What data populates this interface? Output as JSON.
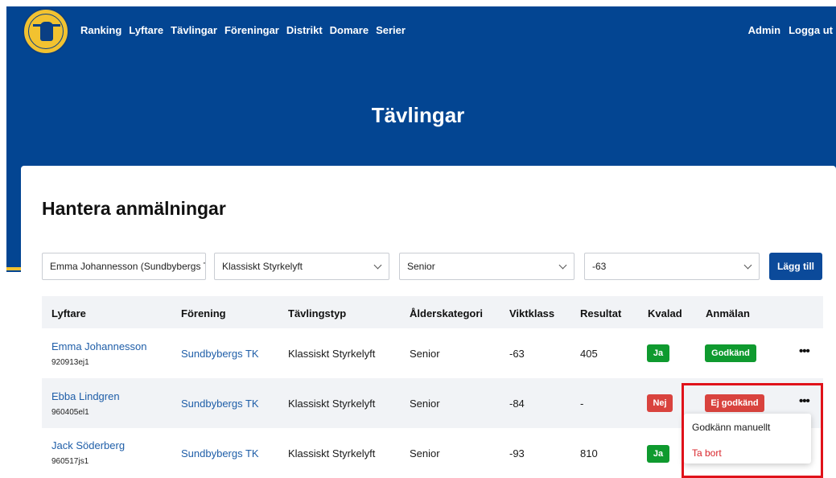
{
  "nav": {
    "items": [
      "Ranking",
      "Lyftare",
      "Tävlingar",
      "Föreningar",
      "Distrikt",
      "Domare",
      "Serier"
    ],
    "right": [
      "Admin",
      "Logga ut"
    ]
  },
  "hero": {
    "title": "Tävlingar"
  },
  "section": {
    "title": "Hantera anmälningar"
  },
  "filters": {
    "lifter": "Emma Johannesson (Sundbybergs T",
    "competition_type": "Klassiskt Styrkelyft",
    "age_category": "Senior",
    "weight_class": "-63",
    "add_label": "Lägg till"
  },
  "table": {
    "headers": [
      "Lyftare",
      "Förening",
      "Tävlingstyp",
      "Ålderskategori",
      "Viktklass",
      "Resultat",
      "Kvalad",
      "Anmälan"
    ],
    "rows": [
      {
        "name": "Emma Johannesson",
        "id": "920913ej1",
        "club": "Sundbybergs TK",
        "type": "Klassiskt Styrkelyft",
        "age": "Senior",
        "weight": "-63",
        "result": "405",
        "qualified": "Ja",
        "status": "Godkänd"
      },
      {
        "name": "Ebba Lindgren",
        "id": "960405el1",
        "club": "Sundbybergs TK",
        "type": "Klassiskt Styrkelyft",
        "age": "Senior",
        "weight": "-84",
        "result": "-",
        "qualified": "Nej",
        "status": "Ej godkänd"
      },
      {
        "name": "Jack Söderberg",
        "id": "960517js1",
        "club": "Sundbybergs TK",
        "type": "Klassiskt Styrkelyft",
        "age": "Senior",
        "weight": "-93",
        "result": "810",
        "qualified": "Ja",
        "status": ""
      }
    ],
    "more_label": "•••"
  },
  "menu": {
    "approve": "Godkänn manuellt",
    "remove": "Ta bort"
  },
  "colors": {
    "brand_blue": "#034592",
    "accent_yellow": "#f2c230",
    "ok_green": "#0f9a2f",
    "no_red": "#d9433e",
    "highlight_red": "#e0121a"
  }
}
